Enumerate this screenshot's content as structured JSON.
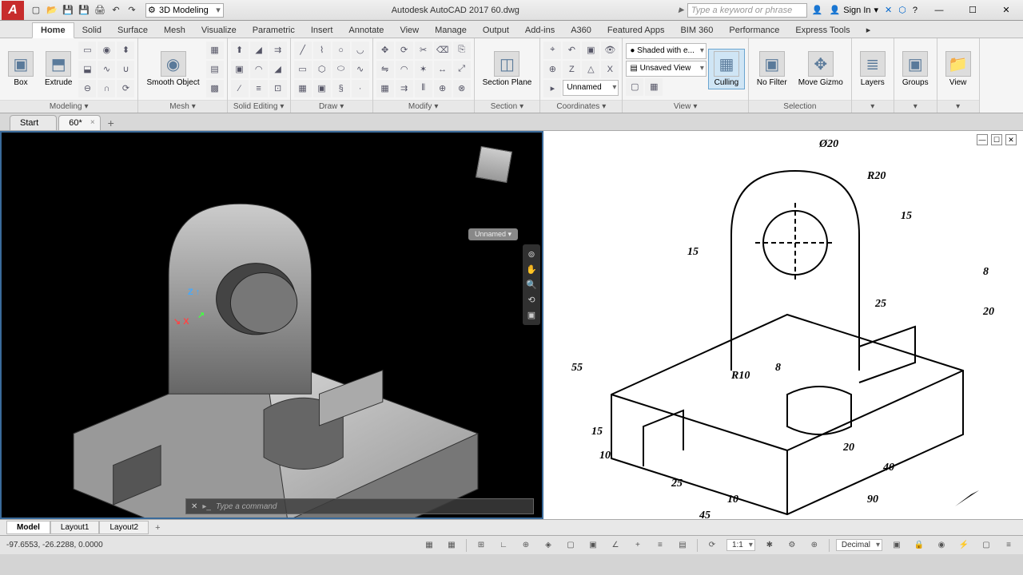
{
  "titlebar": {
    "workspace": "3D Modeling",
    "title": "Autodesk AutoCAD 2017   60.dwg",
    "search_placeholder": "Type a keyword or phrase",
    "signin": "Sign In"
  },
  "ribbon_tabs": [
    "Home",
    "Solid",
    "Surface",
    "Mesh",
    "Visualize",
    "Parametric",
    "Insert",
    "Annotate",
    "View",
    "Manage",
    "Output",
    "Add-ins",
    "A360",
    "Featured Apps",
    "BIM 360",
    "Performance",
    "Express Tools"
  ],
  "active_ribbon_tab": "Home",
  "panels": {
    "modeling": {
      "title": "Modeling",
      "box": "Box",
      "extrude": "Extrude"
    },
    "mesh": {
      "title": "Mesh",
      "smooth": "Smooth Object"
    },
    "solid_editing": {
      "title": "Solid Editing"
    },
    "draw": {
      "title": "Draw"
    },
    "modify": {
      "title": "Modify"
    },
    "section": {
      "title": "Section",
      "plane": "Section Plane"
    },
    "coordinates": {
      "title": "Coordinates",
      "unnamed": "Unnamed"
    },
    "view": {
      "title": "View",
      "shaded": "Shaded with e...",
      "unsaved": "Unsaved View",
      "culling": "Culling"
    },
    "selection": {
      "title": "Selection",
      "nofilter": "No Filter",
      "gizmo": "Move Gizmo"
    },
    "layers": {
      "title": "Layers",
      "btn": "Layers"
    },
    "groups": {
      "title": "Groups",
      "btn": "Groups"
    },
    "viewp": {
      "title": "View",
      "btn": "View"
    }
  },
  "file_tabs": {
    "start": "Start",
    "current": "60*"
  },
  "viewport": {
    "unnamed": "Unnamed",
    "cmd_placeholder": "Type a command"
  },
  "drawing_dims": {
    "d20": "Ø20",
    "r20": "R20",
    "r10": "R10",
    "v15a": "15",
    "v15b": "15",
    "v8a": "8",
    "v8b": "8",
    "v20": "20",
    "v25a": "25",
    "v25b": "25",
    "v55": "55",
    "v10a": "10",
    "v10b": "10",
    "v20b": "20",
    "v40": "40",
    "v45": "45",
    "v90": "90"
  },
  "layout_tabs": [
    "Model",
    "Layout1",
    "Layout2"
  ],
  "status": {
    "coords": "-97.6553, -26.2288, 0.0000",
    "scale": "1:1",
    "units": "Decimal"
  }
}
